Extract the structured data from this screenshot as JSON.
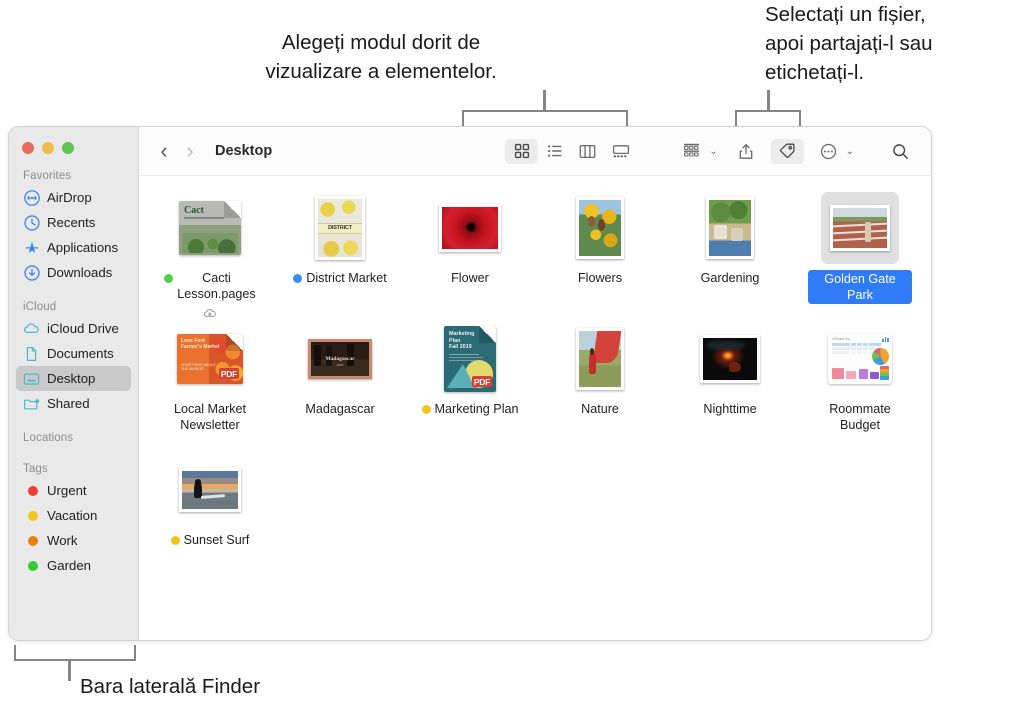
{
  "annotations": {
    "view_modes": "Alegeți modul dorit de\nvizualizare a elementelor.",
    "select_share": "Selectați un fișier,\napoi partajați-l sau\netichetați-l.",
    "sidebar_caption": "Bara laterală Finder"
  },
  "window": {
    "traffic_lights": [
      "close-button",
      "minimize-button",
      "maximize-button"
    ]
  },
  "toolbar": {
    "back_label": "‹",
    "forward_label": "›",
    "folder_title": "Desktop",
    "buttons": [
      {
        "name": "icon-view-button",
        "icon": "grid-icon",
        "active": true
      },
      {
        "name": "list-view-button",
        "icon": "list-icon",
        "active": false
      },
      {
        "name": "column-view-button",
        "icon": "columns-icon",
        "active": false
      },
      {
        "name": "gallery-view-button",
        "icon": "gallery-icon",
        "active": false
      },
      {
        "name": "group-by-button",
        "icon": "group-by-icon",
        "active": false
      },
      {
        "name": "share-button",
        "icon": "share-icon",
        "active": false
      },
      {
        "name": "tag-button",
        "icon": "tag-icon",
        "active": true
      },
      {
        "name": "more-actions-button",
        "icon": "ellipsis-icon",
        "active": false
      },
      {
        "name": "search-button",
        "icon": "search-icon",
        "active": false
      }
    ],
    "chevron": "⌄"
  },
  "sidebar": {
    "groups": [
      {
        "title": "Favorites",
        "items": [
          {
            "label": "AirDrop",
            "icon": "airdrop-icon",
            "color": "#2f7cf6",
            "selected": false
          },
          {
            "label": "Recents",
            "icon": "clock-icon",
            "color": "#2f7cf6",
            "selected": false
          },
          {
            "label": "Applications",
            "icon": "applications-icon",
            "color": "#2f7cf6",
            "selected": false
          },
          {
            "label": "Downloads",
            "icon": "download-icon",
            "color": "#2f7cf6",
            "selected": false
          }
        ]
      },
      {
        "title": "iCloud",
        "items": [
          {
            "label": "iCloud Drive",
            "icon": "cloud-icon",
            "color": "#4fb8cc",
            "selected": false
          },
          {
            "label": "Documents",
            "icon": "document-icon",
            "color": "#4fb8cc",
            "selected": false
          },
          {
            "label": "Desktop",
            "icon": "desktop-icon",
            "color": "#4fb8cc",
            "selected": true
          },
          {
            "label": "Shared",
            "icon": "shared-folder-icon",
            "color": "#4fb8cc",
            "selected": false
          }
        ]
      },
      {
        "title": "Locations",
        "items": []
      },
      {
        "title": "Tags",
        "items": [
          {
            "label": "Urgent",
            "icon": "tag-dot",
            "color": "#f03e30",
            "selected": false
          },
          {
            "label": "Vacation",
            "icon": "tag-dot",
            "color": "#f5c321",
            "selected": false
          },
          {
            "label": "Work",
            "icon": "tag-dot",
            "color": "#e8800c",
            "selected": false
          },
          {
            "label": "Garden",
            "icon": "tag-dot",
            "color": "#2fcc3b",
            "selected": false
          }
        ]
      }
    ]
  },
  "files": [
    {
      "label": "Cacti\nLesson.pages",
      "kind": "pages-doc",
      "tag": "#4ece4a",
      "cloud": true,
      "selected": false
    },
    {
      "label": "District Market",
      "kind": "flyer-photo",
      "tag": "#3b8cf5",
      "cloud": false,
      "selected": false
    },
    {
      "label": "Flower",
      "kind": "photo-red",
      "tag": null,
      "cloud": false,
      "selected": false
    },
    {
      "label": "Flowers",
      "kind": "photo-sunflower",
      "tag": null,
      "cloud": false,
      "selected": false
    },
    {
      "label": "Gardening",
      "kind": "photo-garden",
      "tag": null,
      "cloud": false,
      "selected": false
    },
    {
      "label": "Golden Gate Park",
      "kind": "photo-track",
      "tag": null,
      "cloud": false,
      "selected": true
    },
    {
      "label": "Local Market\nNewsletter",
      "kind": "pdf-orange",
      "tag": null,
      "cloud": false,
      "selected": false
    },
    {
      "label": "Madagascar",
      "kind": "photo-mada",
      "tag": null,
      "cloud": false,
      "selected": false
    },
    {
      "label": "Marketing Plan",
      "kind": "pdf-teal",
      "tag": "#f5c321",
      "cloud": false,
      "selected": false
    },
    {
      "label": "Nature",
      "kind": "photo-nature",
      "tag": null,
      "cloud": false,
      "selected": false
    },
    {
      "label": "Nighttime",
      "kind": "photo-night",
      "tag": null,
      "cloud": false,
      "selected": false
    },
    {
      "label": "Roommate\nBudget",
      "kind": "numbers-doc",
      "tag": null,
      "cloud": false,
      "selected": false
    },
    {
      "label": "Sunset Surf",
      "kind": "photo-sunset",
      "tag": "#f5c321",
      "cloud": false,
      "selected": false
    }
  ],
  "colors": {
    "selection_blue": "#2f7cf6",
    "sidebar_bg": "#e9e9e9",
    "sidebar_selected": "#c9c9c9",
    "toolbar_bg": "#fcfcfc",
    "callout_gray": "#858585"
  }
}
